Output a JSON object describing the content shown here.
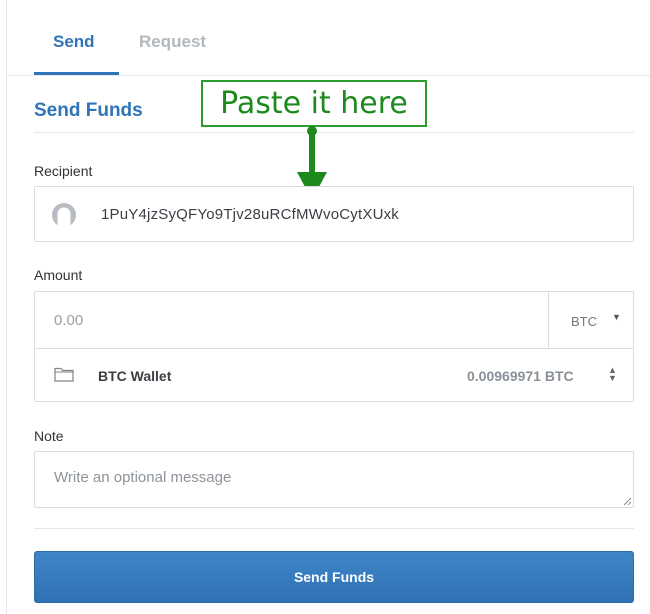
{
  "tabs": [
    {
      "label": "Send",
      "active": true
    },
    {
      "label": "Request",
      "active": false
    }
  ],
  "section_title": "Send Funds",
  "annotation": {
    "text": "Paste it here",
    "color": "#2e9b2e"
  },
  "recipient": {
    "label": "Recipient",
    "value": "1PuY4jzSyQFYo9Tjv28uRCfMWvoCytXUxk"
  },
  "amount": {
    "label": "Amount",
    "placeholder": "0.00",
    "currency": "BTC",
    "wallet_name": "BTC Wallet",
    "wallet_balance": "0.00969971 BTC"
  },
  "note": {
    "label": "Note",
    "placeholder": "Write an optional message"
  },
  "submit_label": "Send Funds",
  "colors": {
    "accent": "#2f74b9",
    "button": "#3579bb",
    "annotation": "#2e9b2e"
  },
  "icons": [
    "avatar-icon",
    "caret-down-icon",
    "folder-icon",
    "sort-updown-icon",
    "arrow-down-icon",
    "resize-handle-icon"
  ]
}
